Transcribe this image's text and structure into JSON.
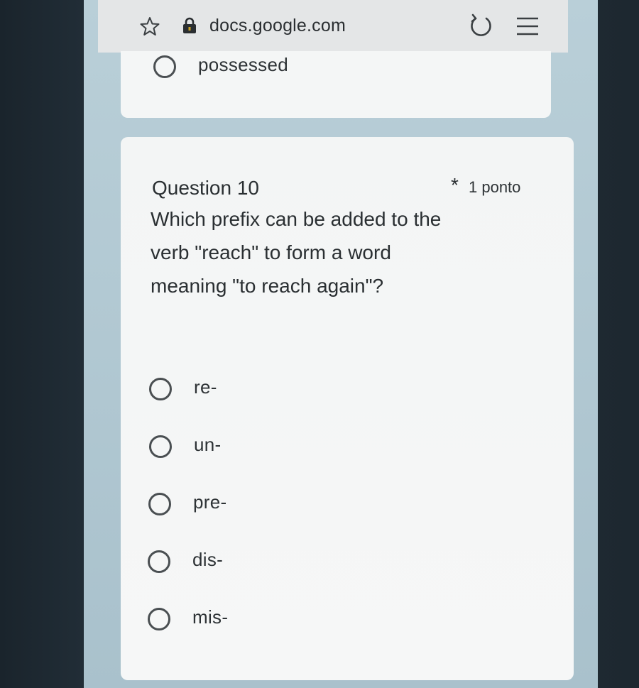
{
  "browser": {
    "url": "docs.google.com",
    "icons": [
      "star-icon",
      "lock-icon",
      "reload-icon",
      "menu-icon"
    ]
  },
  "previous_question": {
    "last_option": "possessed"
  },
  "question": {
    "title": "Question 10",
    "required_marker": "*",
    "points": "1 ponto",
    "text": "Which prefix can be added to the verb \"reach\" to form a word meaning \"to reach again\"?",
    "options": [
      "re-",
      "un-",
      "pre-",
      "dis-",
      "mis-"
    ]
  }
}
